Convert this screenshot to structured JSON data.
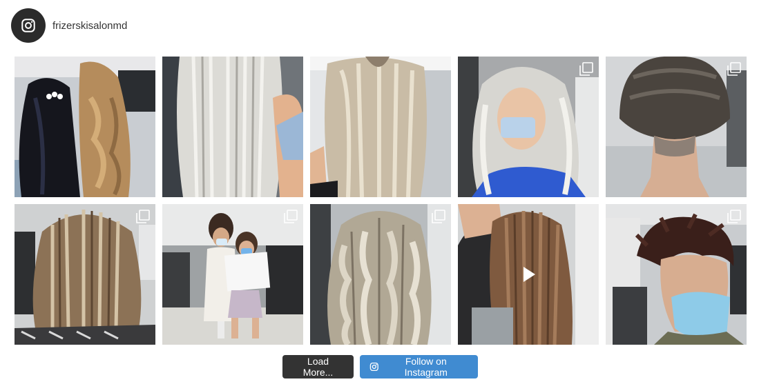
{
  "profile": {
    "username": "frizerskisalonmd",
    "avatar_icon": "instagram-icon"
  },
  "feed": {
    "posts": [
      {
        "type": "image",
        "subject": "long dark hair and blonde curls"
      },
      {
        "type": "image",
        "subject": "platinum straight hair"
      },
      {
        "type": "image",
        "subject": "blonde balayage straight hair"
      },
      {
        "type": "carousel",
        "subject": "platinum wavy hair"
      },
      {
        "type": "carousel",
        "subject": "short bob undercut"
      },
      {
        "type": "carousel",
        "subject": "highlighted bob"
      },
      {
        "type": "carousel",
        "subject": "mother and daughter with masks"
      },
      {
        "type": "carousel",
        "subject": "ash blonde waves"
      },
      {
        "type": "video",
        "subject": "brown straight hair"
      },
      {
        "type": "carousel",
        "subject": "short pixie cut"
      }
    ]
  },
  "buttons": {
    "load_more": "Load More...",
    "follow": "Follow on Instagram"
  },
  "colors": {
    "load_more_bg": "#333333",
    "follow_bg": "#408bd1",
    "avatar_bg": "#2b2b2b"
  }
}
